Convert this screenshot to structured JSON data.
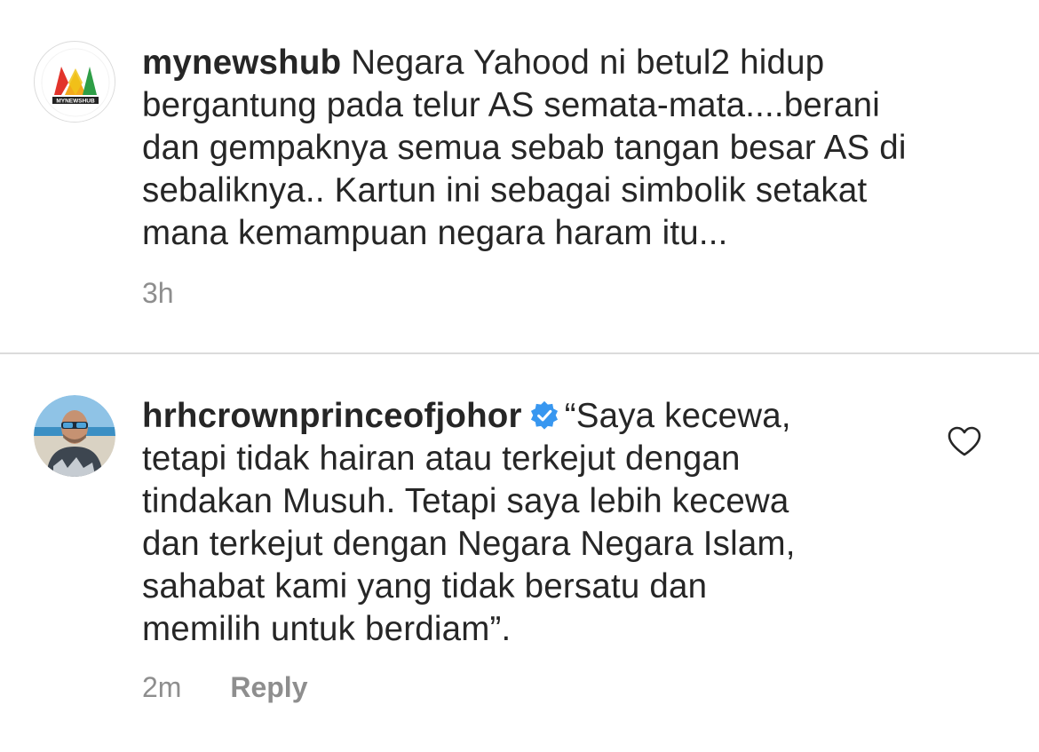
{
  "comments": [
    {
      "username": "mynewshub",
      "avatar_logo_text": "MYNEWSHUB",
      "text_lines": [
        " Negara Yahood ni betul2 hidup",
        "bergantung pada telur AS semata-mata....berani",
        "dan gempaknya semua sebab tangan besar AS di",
        "sebaliknya.. Kartun ini sebagai simbolik setakat",
        "mana kemampuan negara haram itu..."
      ],
      "time": "3h"
    },
    {
      "username": "hrhcrownprinceofjohor",
      "verified": true,
      "text_lines": [
        "“Saya kecewa,",
        "tetapi tidak hairan atau terkejut dengan",
        "tindakan Musuh. Tetapi saya lebih kecewa",
        "dan terkejut dengan Negara Negara Islam,",
        "sahabat kami yang tidak bersatu dan",
        "memilih untuk berdiam”."
      ],
      "time": "2m",
      "reply_label": "Reply",
      "like_icon": "heart-outline-icon"
    }
  ],
  "colors": {
    "text": "#262626",
    "meta": "#8e8e8e",
    "verified": "#3897f0",
    "divider": "#dbdbdb"
  }
}
